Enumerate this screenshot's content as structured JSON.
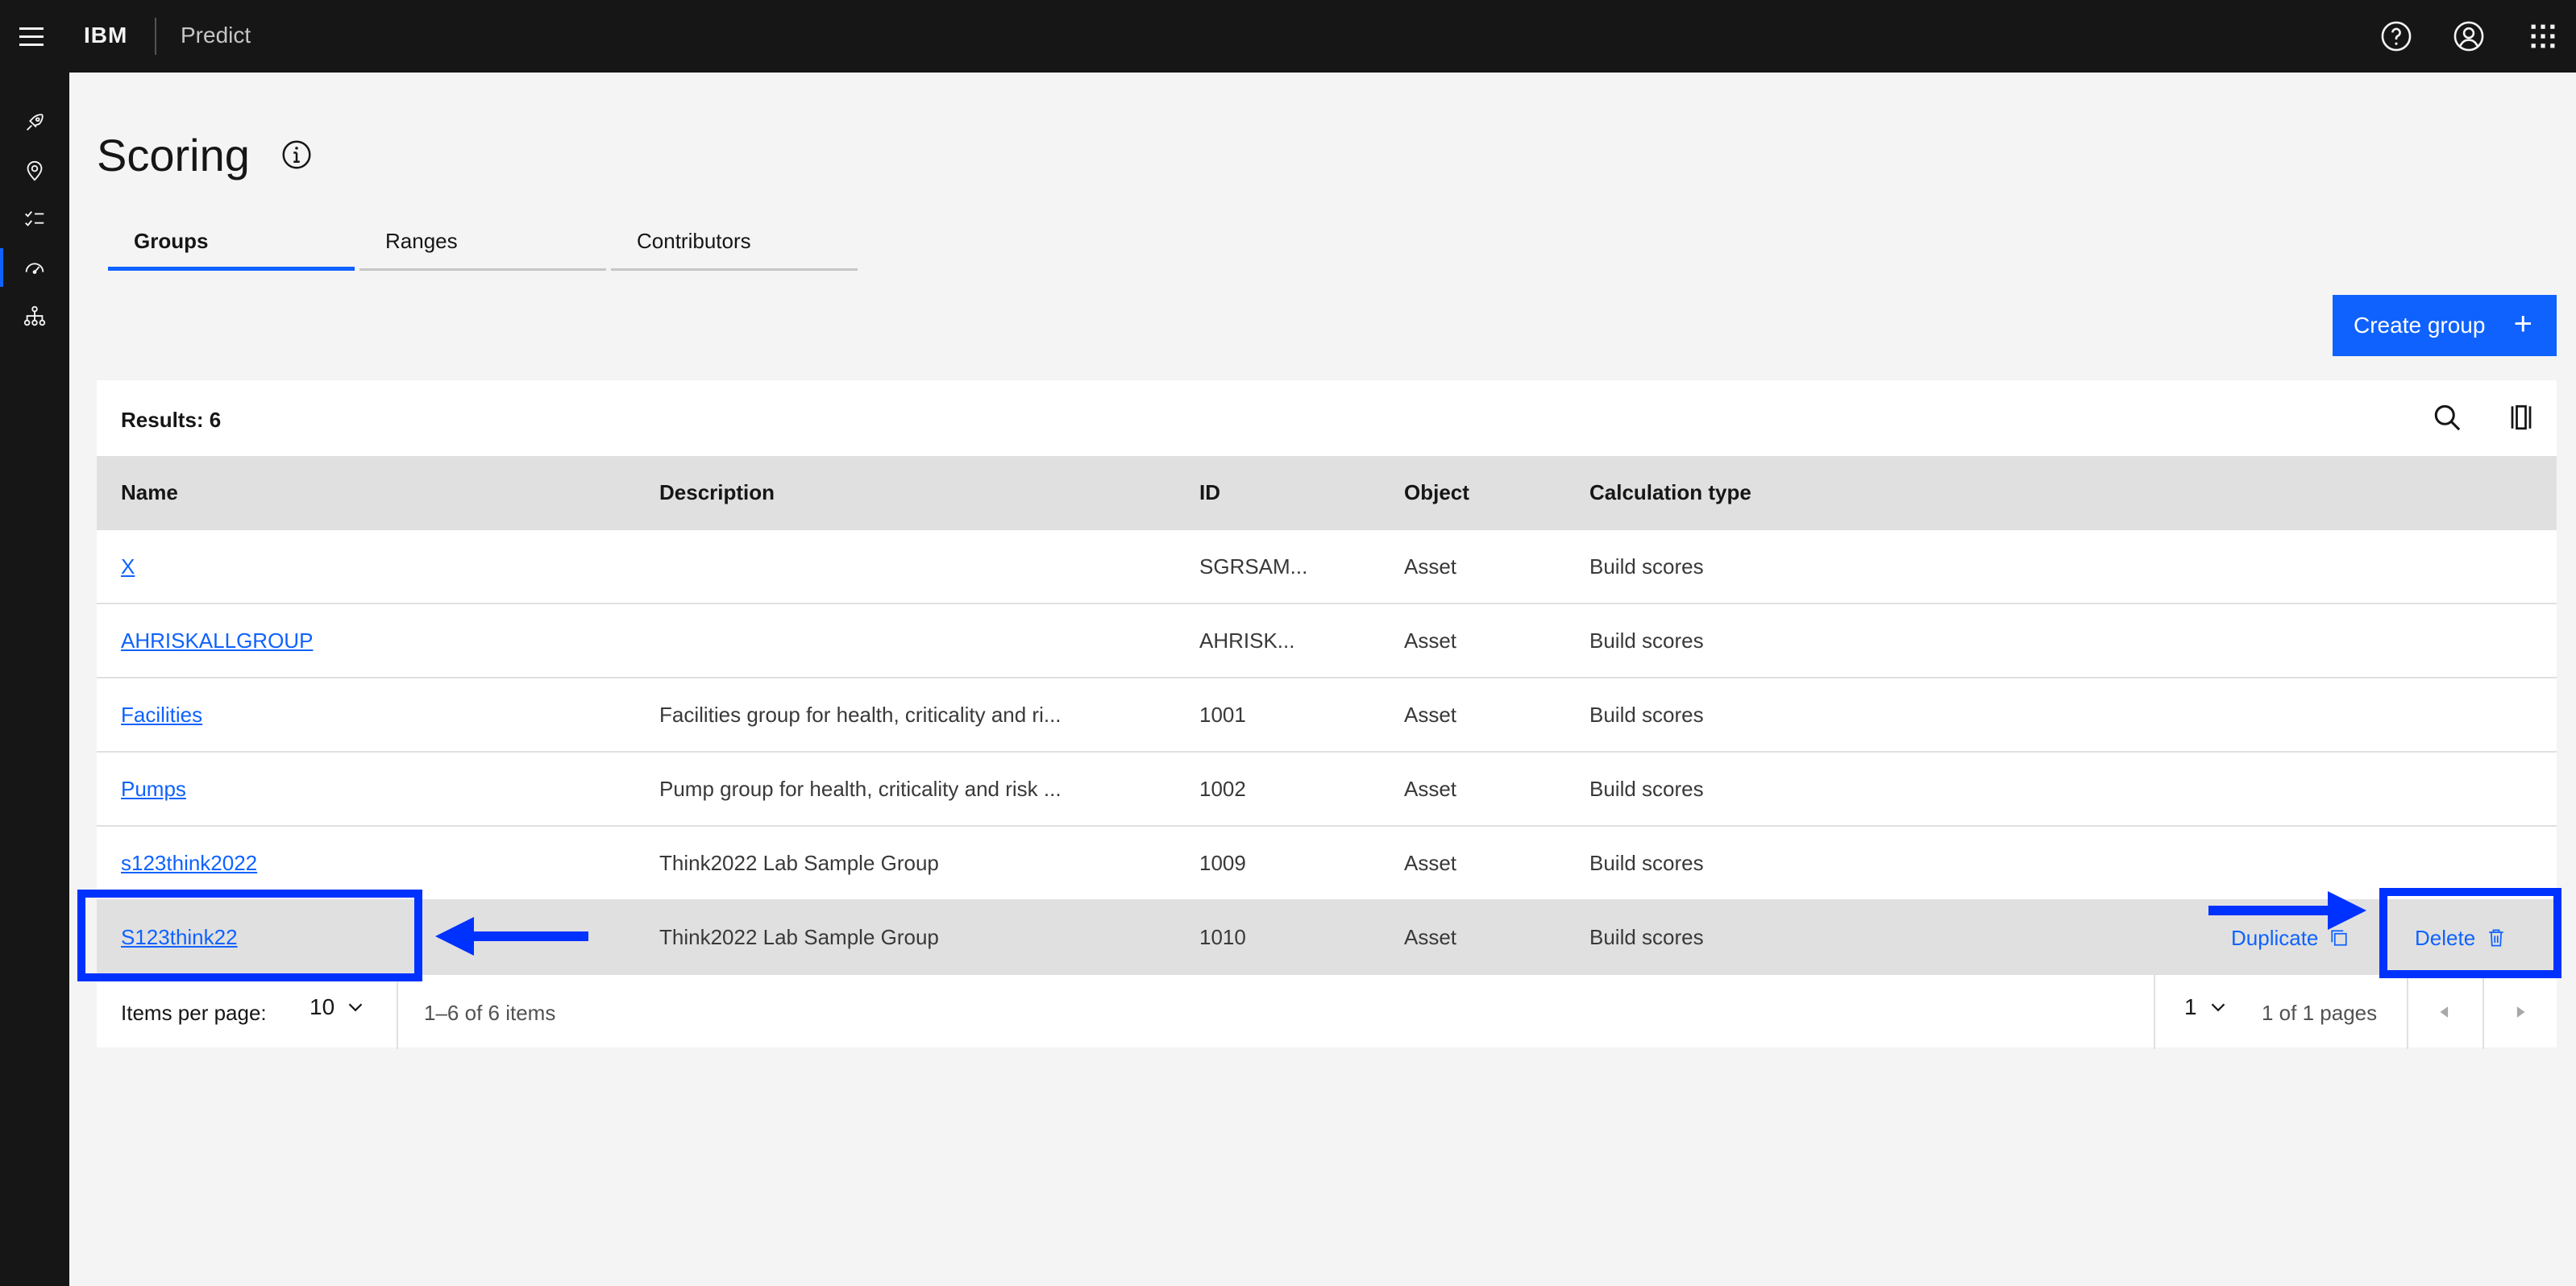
{
  "header": {
    "brand": "IBM",
    "product": "Predict",
    "icons": [
      "menu-icon",
      "help-icon",
      "user-icon",
      "app-switcher-icon"
    ]
  },
  "rail": {
    "icons": [
      "overview-icon",
      "location-icon",
      "checklist-icon",
      "scoring-gauge-icon",
      "hierarchy-icon"
    ],
    "active_index": 3
  },
  "page": {
    "title": "Scoring",
    "tabs": [
      {
        "label": "Groups",
        "active": true
      },
      {
        "label": "Ranges",
        "active": false
      },
      {
        "label": "Contributors",
        "active": false
      }
    ],
    "create_button": "Create group"
  },
  "table": {
    "results_label": "Results: 6",
    "columns": [
      "Name",
      "Description",
      "ID",
      "Object",
      "Calculation type"
    ],
    "rows": [
      {
        "name": "X",
        "description": "",
        "id": "SGRSAM...",
        "object": "Asset",
        "calc": "Build scores"
      },
      {
        "name": "AHRISKALLGROUP",
        "description": "",
        "id": "AHRISK...",
        "object": "Asset",
        "calc": "Build scores"
      },
      {
        "name": "Facilities",
        "description": "Facilities group for health, criticality and ri...",
        "id": "1001",
        "object": "Asset",
        "calc": "Build scores"
      },
      {
        "name": "Pumps",
        "description": "Pump group for health, criticality and risk ...",
        "id": "1002",
        "object": "Asset",
        "calc": "Build scores"
      },
      {
        "name": "s123think2022",
        "description": "Think2022 Lab Sample Group",
        "id": "1009",
        "object": "Asset",
        "calc": "Build scores"
      },
      {
        "name": "S123think22",
        "description": "Think2022 Lab Sample Group",
        "id": "1010",
        "object": "Asset",
        "calc": "Build scores"
      }
    ],
    "row_actions": {
      "duplicate": "Duplicate",
      "delete": "Delete"
    },
    "pagination": {
      "items_per_page_label": "Items per page:",
      "items_per_page": "10",
      "range": "1–6 of 6 items",
      "page": "1",
      "page_of": "1 of 1 pages"
    }
  },
  "colors": {
    "accent": "#0f62fe",
    "header_bg": "#161616",
    "annotation": "#0032ff"
  }
}
